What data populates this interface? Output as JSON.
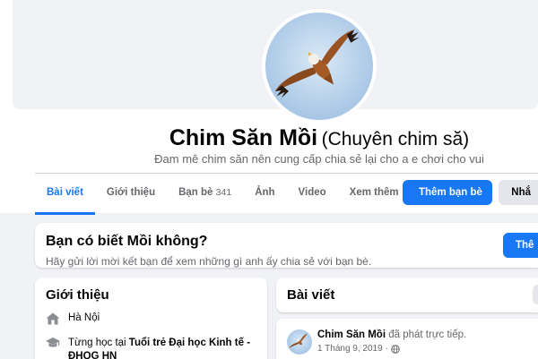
{
  "profile": {
    "name": "Chim Săn Mồi",
    "alt_name": "(Chuyên chim să)",
    "bio": "Đam mê chim săn nên cung cấp chia sẻ lại cho a e chơi cho vui"
  },
  "tabs": [
    {
      "label": "Bài viết",
      "active": true
    },
    {
      "label": "Giới thiệu"
    },
    {
      "label": "Bạn bè",
      "count": "341"
    },
    {
      "label": "Ảnh"
    },
    {
      "label": "Video"
    },
    {
      "label": "Xem thêm"
    }
  ],
  "actions": {
    "add_friend": "Thêm bạn bè",
    "message": "Nhắ"
  },
  "suggestion": {
    "title": "Bạn có biết Mồi không?",
    "subtitle": "Hãy gửi lời mời kết bạn để xem những gì anh ấy chia sẻ với bạn bè.",
    "button": "Thê"
  },
  "intro": {
    "title": "Giới thiệu",
    "location": "Hà Nội",
    "study_prefix": "Từng học tại ",
    "school": "Tuổi trẻ Đại học Kinh tế - ĐHQG HN"
  },
  "posts": {
    "title": "Bài viết",
    "author": "Chim Săn Mồi",
    "action": "đã phát trực tiếp.",
    "date": "1 Tháng 9, 2019",
    "separator": "·"
  },
  "colors": {
    "accent": "#1877f2",
    "background": "#f0f2f5",
    "secondary_text": "#65676b"
  }
}
